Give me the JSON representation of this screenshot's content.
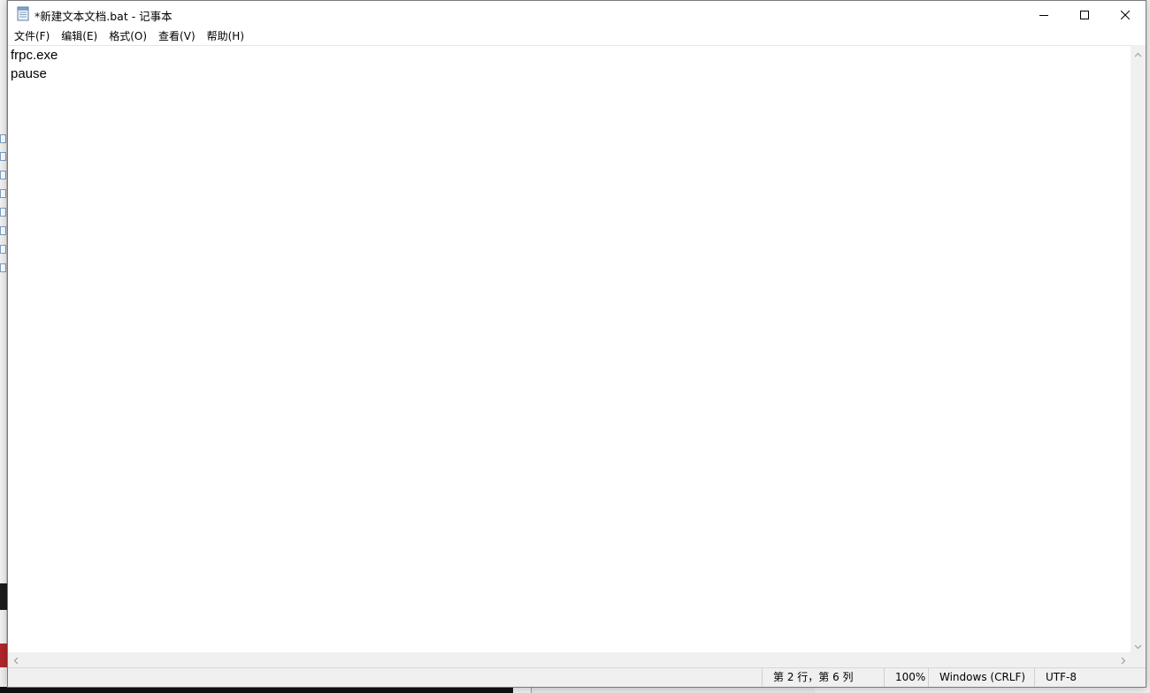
{
  "window": {
    "title": "*新建文本文档.bat - 记事本"
  },
  "menu": [
    {
      "label": "文件(F)"
    },
    {
      "label": "编辑(E)"
    },
    {
      "label": "格式(O)"
    },
    {
      "label": "查看(V)"
    },
    {
      "label": "帮助(H)"
    }
  ],
  "editor": {
    "lines": [
      "frpc.exe",
      "pause"
    ]
  },
  "statusbar": {
    "position": "第 2 行，第 6 列",
    "zoom": "100%",
    "line_ending": "Windows (CRLF)",
    "encoding": "UTF-8"
  },
  "icons": {
    "app": "notepad-icon",
    "minimize": "minimize-icon",
    "maximize": "maximize-icon",
    "close": "close-icon"
  }
}
